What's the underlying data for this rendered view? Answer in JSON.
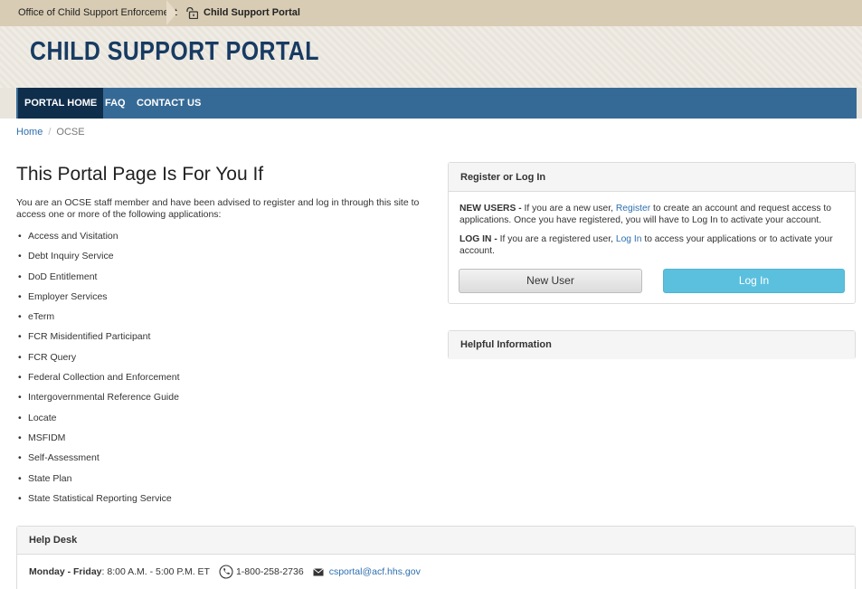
{
  "topbar": {
    "org": "Office of Child Support Enforcement",
    "portal": "Child Support Portal"
  },
  "banner": {
    "title": "CHILD SUPPORT PORTAL"
  },
  "nav": {
    "items": [
      "PORTAL HOME",
      "FAQ",
      "CONTACT US"
    ],
    "active": "PORTAL HOME"
  },
  "breadcrumb": {
    "home": "Home",
    "sep": "/",
    "current": "OCSE"
  },
  "main": {
    "heading": "This Portal Page Is For You If",
    "intro": "You are an OCSE staff member and have been advised to register and log in through this site to access one or more of the following applications:",
    "apps": [
      "Access and Visitation",
      "Debt Inquiry Service",
      "DoD Entitlement",
      "Employer Services",
      "eTerm",
      "FCR Misidentified Participant",
      "FCR Query",
      "Federal Collection and Enforcement",
      "Intergovernmental Reference Guide",
      "Locate",
      "MSFIDM",
      "Self-Assessment",
      "State Plan",
      "State Statistical Reporting Service"
    ]
  },
  "register": {
    "heading": "Register or Log In",
    "new_users_label": "NEW USERS -",
    "new_users_pre": " If you are a new user, ",
    "register_link": "Register",
    "new_users_post": " to create an account and request access to applications. Once you have registered, you will have to Log In to activate your account.",
    "login_label": "LOG IN -",
    "login_pre": " If you are a registered user, ",
    "login_link": "Log In",
    "login_post": " to access your applications or to activate your account.",
    "new_user_button": "New User",
    "login_button": "Log In"
  },
  "helpful": {
    "heading": "Helpful Information"
  },
  "helpdesk": {
    "heading": "Help Desk",
    "days": "Monday - Friday",
    "hours": ": 8:00 A.M. - 5:00 P.M. ET",
    "phone": "1-800-258-2736",
    "email": "csportal@acf.hhs.gov"
  },
  "colors": {
    "nav": "#366a96",
    "nav_active": "#0f2e4c",
    "login_button": "#5bc0de",
    "banner_title": "#173b63"
  }
}
